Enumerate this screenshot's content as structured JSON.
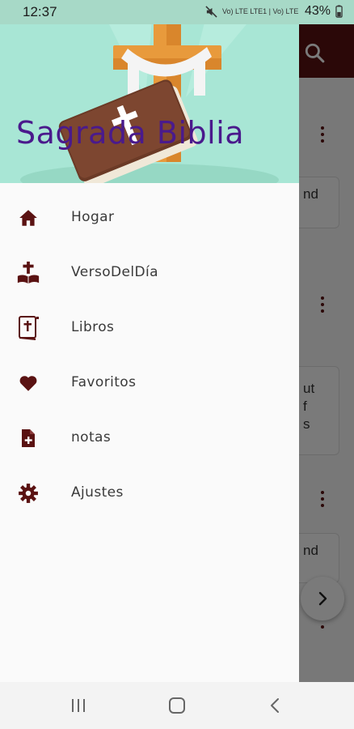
{
  "status_bar": {
    "time": "12:37",
    "network": "Vo) LTE LTE1 | Vo) LTE LTE2",
    "battery": "43%"
  },
  "drawer": {
    "title": "Sagrada Biblia",
    "items": [
      {
        "label": "Hogar",
        "icon": "home-icon"
      },
      {
        "label": "VersoDelDía",
        "icon": "cross-book-icon"
      },
      {
        "label": "Libros",
        "icon": "bible-icon"
      },
      {
        "label": "Favoritos",
        "icon": "heart-icon"
      },
      {
        "label": "notas",
        "icon": "note-add-icon"
      },
      {
        "label": "Ajustes",
        "icon": "gear-icon"
      }
    ]
  },
  "background": {
    "card_text_1": "nd",
    "card_text_2a": "ut",
    "card_text_2b": "f",
    "card_text_2c": "s",
    "card_text_3": "nd"
  },
  "colors": {
    "accent": "#5a1212",
    "header_bg": "#a8e6d5",
    "title": "#4a1a8c"
  }
}
